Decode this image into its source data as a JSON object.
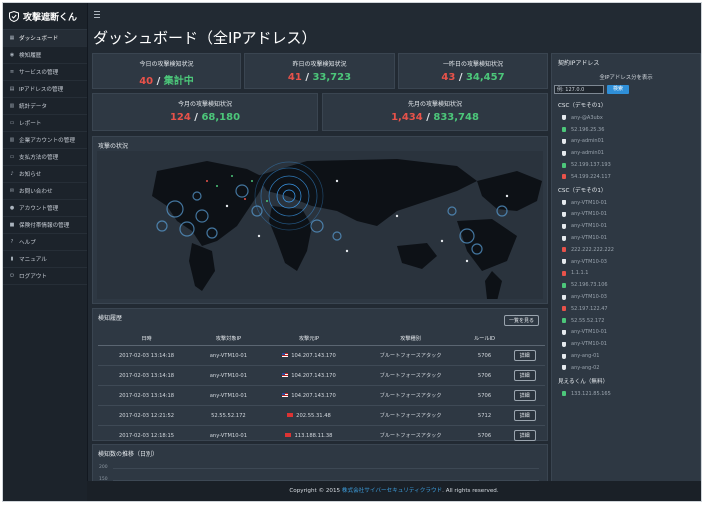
{
  "sidebar": {
    "brand": "攻撃遮断くん",
    "items": [
      {
        "label": "ダッシュボード",
        "icon": "dashboard-icon",
        "active": true
      },
      {
        "label": "検知履歴",
        "icon": "eye-icon"
      },
      {
        "label": "サービスの管理",
        "icon": "list-icon"
      },
      {
        "label": "IPアドレスの管理",
        "icon": "server-icon"
      },
      {
        "label": "統計データ",
        "icon": "chart-icon"
      },
      {
        "label": "レポート",
        "icon": "document-icon"
      },
      {
        "label": "企業アカウントの管理",
        "icon": "building-icon"
      },
      {
        "label": "支払方法の管理",
        "icon": "card-icon"
      },
      {
        "label": "お知らせ",
        "icon": "bell-icon"
      },
      {
        "label": "お問い合わせ",
        "icon": "mail-icon"
      },
      {
        "label": "アカウント管理",
        "icon": "user-icon"
      },
      {
        "label": "保険付帯情報の管理",
        "icon": "lock-icon"
      },
      {
        "label": "ヘルプ",
        "icon": "help-icon"
      },
      {
        "label": "マニュアル",
        "icon": "book-icon"
      },
      {
        "label": "ログアウト",
        "icon": "power-icon"
      }
    ]
  },
  "main": {
    "title": "ダッシュボード（全IPアドレス）",
    "stats": [
      {
        "title": "今日の攻撃検知状況",
        "left": "40",
        "sep": " / ",
        "right": "集計中"
      },
      {
        "title": "昨日の攻撃検知状況",
        "left": "41",
        "sep": " / ",
        "right": "33,723"
      },
      {
        "title": "一昨日の攻撃検知状況",
        "left": "43",
        "sep": " / ",
        "right": "34,457"
      },
      {
        "title": "今月の攻撃検知状況",
        "left": "124",
        "sep": " / ",
        "right": "68,180"
      },
      {
        "title": "先月の攻撃検知状況",
        "left": "1,434",
        "sep": " / ",
        "right": "833,748"
      }
    ],
    "map_title": "攻撃の状況",
    "history": {
      "title": "検知履歴",
      "more_label": "一覧を見る",
      "columns": [
        "日時",
        "攻撃対象IP",
        "攻撃元IP",
        "攻撃種別",
        "ルールID",
        ""
      ],
      "detail_label": "詳細",
      "rows": [
        {
          "time": "2017-02-03 13:14:18",
          "target": "any-VTM10-01",
          "source": "104.207.143.170",
          "flag": "us",
          "type": "ブルートフォースアタック",
          "rule": "5706"
        },
        {
          "time": "2017-02-03 13:14:18",
          "target": "any-VTM10-01",
          "source": "104.207.143.170",
          "flag": "us",
          "type": "ブルートフォースアタック",
          "rule": "5706"
        },
        {
          "time": "2017-02-03 13:14:18",
          "target": "any-VTM10-01",
          "source": "104.207.143.170",
          "flag": "us",
          "type": "ブルートフォースアタック",
          "rule": "5706"
        },
        {
          "time": "2017-02-03 12:21:52",
          "target": "52.55.52.172",
          "source": "202.55.31.48",
          "flag": "cn",
          "type": "ブルートフォースアタック",
          "rule": "5712"
        },
        {
          "time": "2017-02-03 12:18:15",
          "target": "any-VTM10-01",
          "source": "113.188.11.38",
          "flag": "cn",
          "type": "ブルートフォースアタック",
          "rule": "5706"
        }
      ]
    },
    "trend_title": "検知数の推移（日別）",
    "trend_ticks": [
      "200",
      "150"
    ]
  },
  "right_panel": {
    "title": "契約IPアドレス",
    "subtitle": "全IPアドレス分を表示",
    "search_placeholder": "例: 127.0.0",
    "search_button": "検索",
    "groups": [
      {
        "name": "CSC（デモその1）",
        "items": [
          {
            "label": "any-@A3ubx",
            "kind": "shield"
          },
          {
            "label": "52.196.25.36",
            "kind": "green"
          },
          {
            "label": "any-admin01",
            "kind": "shield"
          },
          {
            "label": "any-admin01",
            "kind": "shield"
          },
          {
            "label": "52.199.137.193",
            "kind": "green"
          },
          {
            "label": "54.199.224.117",
            "kind": "red"
          }
        ]
      },
      {
        "name": "CSC（デモその1）",
        "items": [
          {
            "label": "any-VTM10-01",
            "kind": "shield"
          },
          {
            "label": "any-VTM10-01",
            "kind": "shield"
          },
          {
            "label": "any-VTM10-01",
            "kind": "shield"
          },
          {
            "label": "any-VTM10-01",
            "kind": "shield"
          },
          {
            "label": "222.222.222.222",
            "kind": "red"
          },
          {
            "label": "any-VTM10-03",
            "kind": "shield"
          },
          {
            "label": "1.1.1.1",
            "kind": "red"
          },
          {
            "label": "52.196.73.106",
            "kind": "green"
          },
          {
            "label": "any-VTM10-03",
            "kind": "shield"
          },
          {
            "label": "52.197.122.47",
            "kind": "red"
          },
          {
            "label": "52.55.52.172",
            "kind": "green"
          },
          {
            "label": "any-VTM10-01",
            "kind": "shield"
          },
          {
            "label": "any-VTM10-01",
            "kind": "shield"
          },
          {
            "label": "any-ang-01",
            "kind": "shield"
          },
          {
            "label": "any-ang-02",
            "kind": "shield"
          }
        ]
      },
      {
        "name": "見えるくん（無料）",
        "items": [
          {
            "label": "133.121.85.165",
            "kind": "green"
          }
        ]
      }
    ]
  },
  "footer": {
    "prefix": "Copyright © 2015 ",
    "link": "株式会社サイバーセキュリティクラウド",
    "suffix": ". All rights reserved."
  },
  "colors": {
    "red": "#e8524a",
    "green": "#4cc77a",
    "accent": "#2f8fd8",
    "bg": "#222a33",
    "panel": "#2e3843"
  }
}
